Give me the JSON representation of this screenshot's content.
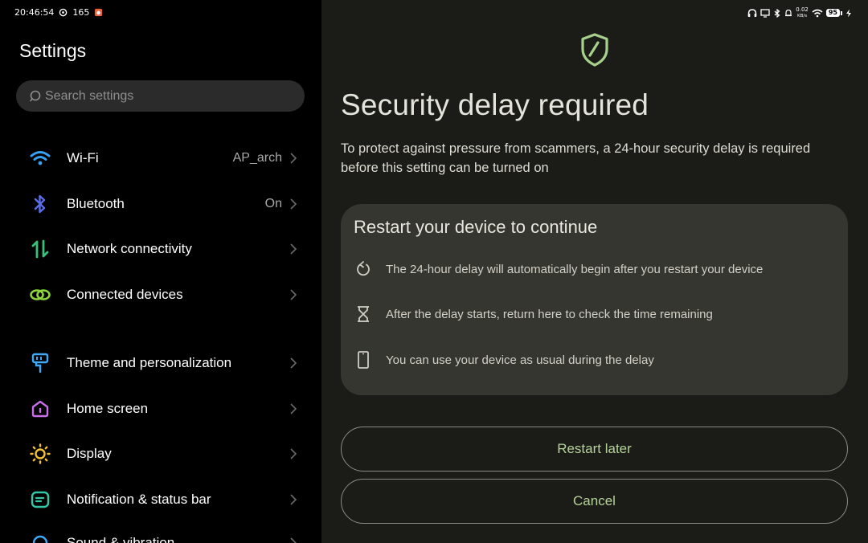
{
  "status_bar": {
    "time": "20:46:54",
    "refresh_rate": "165",
    "network_speed": "0.02",
    "network_speed_unit": "KB/s",
    "battery": "95"
  },
  "settings": {
    "title": "Settings",
    "search_placeholder": "Search settings",
    "items": [
      {
        "label": "Wi-Fi",
        "value": "AP_arch",
        "icon": "wifi-icon"
      },
      {
        "label": "Bluetooth",
        "value": "On",
        "icon": "bluetooth-icon"
      },
      {
        "label": "Network connectivity",
        "value": "",
        "icon": "network-arrows-icon"
      },
      {
        "label": "Connected devices",
        "value": "",
        "icon": "connected-devices-icon"
      },
      {
        "label": "Theme and personalization",
        "value": "",
        "icon": "paintbrush-icon"
      },
      {
        "label": "Home screen",
        "value": "",
        "icon": "home-icon"
      },
      {
        "label": "Display",
        "value": "",
        "icon": "sun-icon"
      },
      {
        "label": "Notification & status bar",
        "value": "",
        "icon": "notification-icon"
      },
      {
        "label": "Sound & vibration",
        "value": "",
        "icon": "sound-icon"
      }
    ]
  },
  "dialog": {
    "title": "Security delay required",
    "description": "To protect against pressure from scammers, a 24-hour security delay is required before this setting can be turned on",
    "card": {
      "title": "Restart your device to continue",
      "rows": [
        {
          "text": "The 24-hour delay will automatically begin after you restart your device",
          "icon": "restart-icon"
        },
        {
          "text": "After the delay starts, return here to check the time remaining",
          "icon": "hourglass-icon"
        },
        {
          "text": "You can use your device as usual during the delay",
          "icon": "phone-icon"
        }
      ]
    },
    "restart_later_label": "Restart later",
    "cancel_label": "Cancel"
  },
  "colors": {
    "accent_green": "#b5d29a",
    "dialog_bg": "#1b1c18",
    "card_bg": "#353630"
  }
}
